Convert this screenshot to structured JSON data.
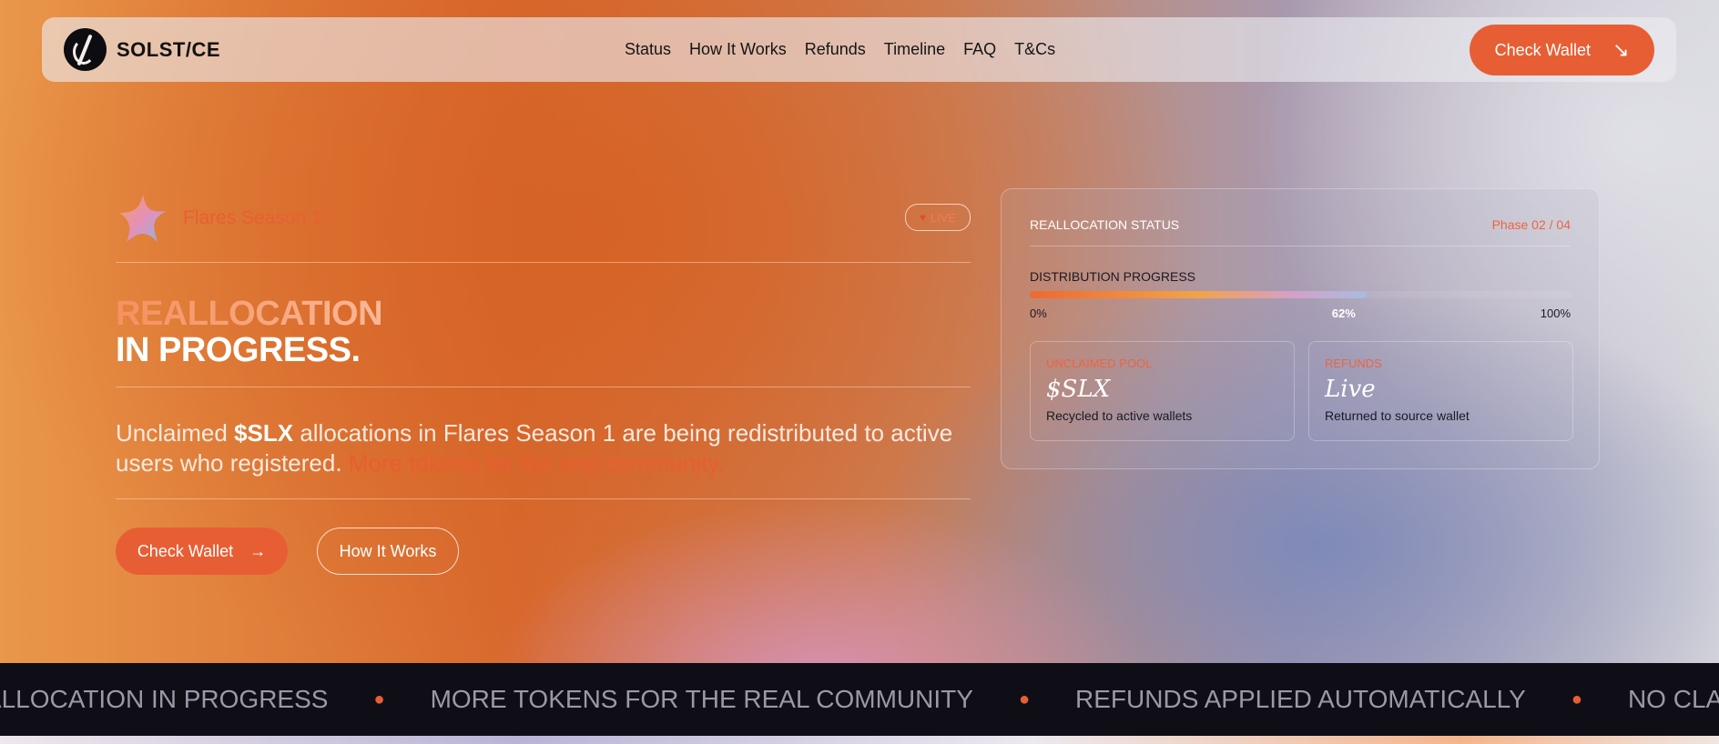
{
  "nav": {
    "logo_text": "SOLST/CE",
    "links": [
      "Status",
      "How It Works",
      "Refunds",
      "Timeline",
      "FAQ",
      "T&Cs"
    ],
    "cta_label": "Check Wallet"
  },
  "hero": {
    "season_label": "Flares Season 1",
    "live_label": "LIVE",
    "title_line1": "REALLOCATION",
    "title_line2": "IN PROGRESS.",
    "desc_pre": "Unclaimed ",
    "desc_token": "$SLX",
    "desc_mid": " allocations in Flares Season 1 are being redistributed to active users who registered. ",
    "desc_highlight": "More tokens for the real community.",
    "primary_button": "Check Wallet",
    "secondary_button": "How It Works"
  },
  "status_panel": {
    "title": "REALLOCATION STATUS",
    "phase": "Phase 02 / 04",
    "progress_label": "DISTRIBUTION PROGRESS",
    "progress_value": 0.62,
    "tick_min": "0%",
    "tick_mid": "62%",
    "tick_max": "100%",
    "cards": [
      {
        "label": "UNCLAIMED POOL",
        "value": "$SLX",
        "sub": "Recycled to active wallets"
      },
      {
        "label": "REFUNDS",
        "value": "Live",
        "sub": "Returned to source wallet"
      }
    ]
  },
  "ticker": {
    "items": [
      "REALLOCATION IN PROGRESS",
      "MORE TOKENS FOR THE REAL COMMUNITY",
      "REFUNDS APPLIED AUTOMATICALLY",
      "NO CLAIM REQUIRED"
    ]
  },
  "colors": {
    "accent": "#e85e34",
    "dark": "#0f0e16"
  }
}
